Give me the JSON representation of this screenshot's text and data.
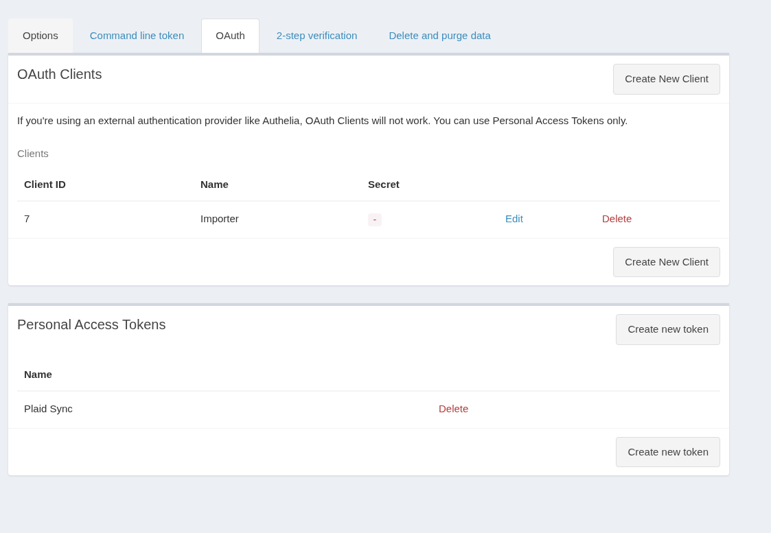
{
  "tabs": [
    {
      "label": "Options",
      "selected": false,
      "hovered": true
    },
    {
      "label": "Command line token",
      "selected": false,
      "hovered": false
    },
    {
      "label": "OAuth",
      "selected": true,
      "hovered": false
    },
    {
      "label": "2-step verification",
      "selected": false,
      "hovered": false
    },
    {
      "label": "Delete and purge data",
      "selected": false,
      "hovered": false
    }
  ],
  "clients_box": {
    "title": "OAuth Clients",
    "header_button": "Create New Client",
    "notice": "If you're using an external authentication provider like Authelia, OAuth Clients will not work. You can use Personal Access Tokens only.",
    "caption": "Clients",
    "columns": [
      "Client ID",
      "Name",
      "Secret"
    ],
    "rows": [
      {
        "client_id": "7",
        "name": "Importer",
        "secret": "-",
        "edit": "Edit",
        "delete": "Delete"
      }
    ],
    "footer_button": "Create New Client"
  },
  "tokens_box": {
    "title": "Personal Access Tokens",
    "header_button": "Create new token",
    "columns": [
      "Name"
    ],
    "rows": [
      {
        "name": "Plaid Sync",
        "delete": "Delete"
      }
    ],
    "footer_button": "Create new token"
  }
}
